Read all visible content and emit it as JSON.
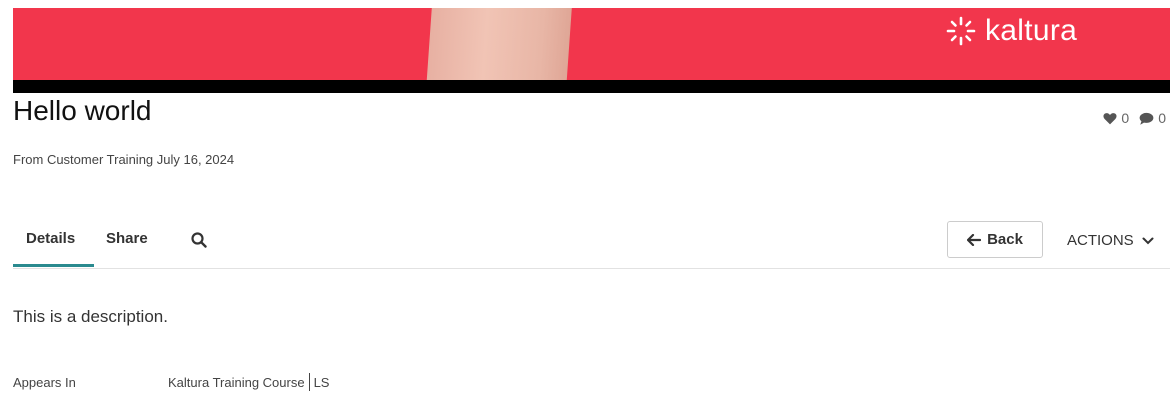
{
  "player": {
    "brand_text": "kaltura",
    "colors": {
      "background": "#f2364c",
      "bar": "#000000"
    },
    "logo_icon": "kaltura-burst-icon"
  },
  "media": {
    "title": "Hello world",
    "likes": "0",
    "comments": "0",
    "meta": "From Customer Training July 16, 2024",
    "description": "This is a description."
  },
  "tabs": [
    {
      "label": "Details",
      "active": true
    },
    {
      "label": "Share",
      "active": false
    }
  ],
  "toolbar": {
    "search_icon": "search-icon",
    "back_label": "Back",
    "actions_label": "ACTIONS"
  },
  "appears_in": {
    "label": "Appears In",
    "items": [
      "Kaltura Training Course",
      "LS"
    ]
  },
  "colors": {
    "accent": "#2a8a8f",
    "text": "#333333"
  }
}
